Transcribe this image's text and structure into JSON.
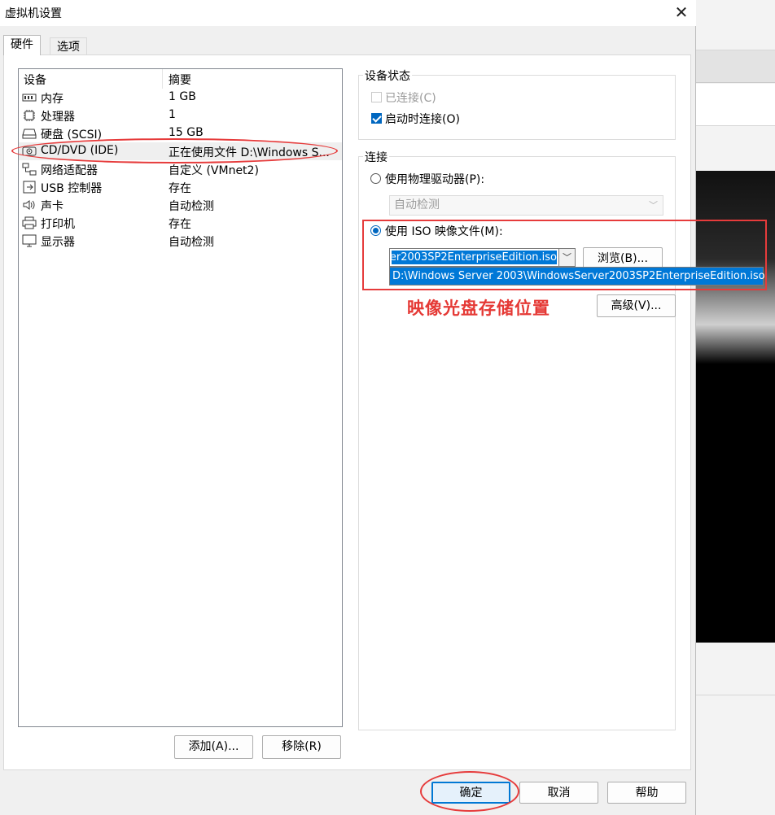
{
  "window": {
    "title": "虚拟机设置"
  },
  "tabs": [
    {
      "label": "硬件"
    },
    {
      "label": "选项"
    }
  ],
  "device_list": {
    "columns": [
      "设备",
      "摘要"
    ],
    "rows": [
      {
        "name": "内存",
        "summary": "1 GB",
        "icon": "memory-icon"
      },
      {
        "name": "处理器",
        "summary": "1",
        "icon": "cpu-icon"
      },
      {
        "name": "硬盘 (SCSI)",
        "summary": "15 GB",
        "icon": "hard-disk-icon"
      },
      {
        "name": "CD/DVD (IDE)",
        "summary": "正在使用文件 D:\\Windows S...",
        "icon": "cd-dvd-icon"
      },
      {
        "name": "网络适配器",
        "summary": "自定义 (VMnet2)",
        "icon": "network-adapter-icon"
      },
      {
        "name": "USB 控制器",
        "summary": "存在",
        "icon": "usb-icon"
      },
      {
        "name": "声卡",
        "summary": "自动检测",
        "icon": "speaker-icon"
      },
      {
        "name": "打印机",
        "summary": "存在",
        "icon": "printer-icon"
      },
      {
        "name": "显示器",
        "summary": "自动检测",
        "icon": "monitor-icon"
      }
    ],
    "add_button": "添加(A)...",
    "remove_button": "移除(R)"
  },
  "device_status": {
    "label": "设备状态",
    "connected": {
      "label": "已连接(C)",
      "checked": false,
      "disabled": true
    },
    "connect_at_power_on": {
      "label": "启动时连接(O)",
      "checked": true
    }
  },
  "connection": {
    "label": "连接",
    "physical_drive": {
      "label": "使用物理驱动器(P):",
      "selected": false,
      "value": "自动检测"
    },
    "iso_image": {
      "label": "使用 ISO 映像文件(M):",
      "selected": true,
      "value": "ver2003SP2EnterpriseEdition.iso",
      "dropdown_option": "D:\\Windows Server 2003\\WindowsServer2003SP2EnterpriseEdition.iso"
    },
    "browse_button": "浏览(B)...",
    "advanced_button": "高级(V)..."
  },
  "annotation": {
    "text": "映像光盘存储位置",
    "color": "#e53935"
  },
  "footer": {
    "ok_button": "确定",
    "cancel_button": "取消",
    "help_button": "帮助"
  },
  "colors": {
    "accent": "#0078d7",
    "annotation_red": "#e63b3b"
  }
}
